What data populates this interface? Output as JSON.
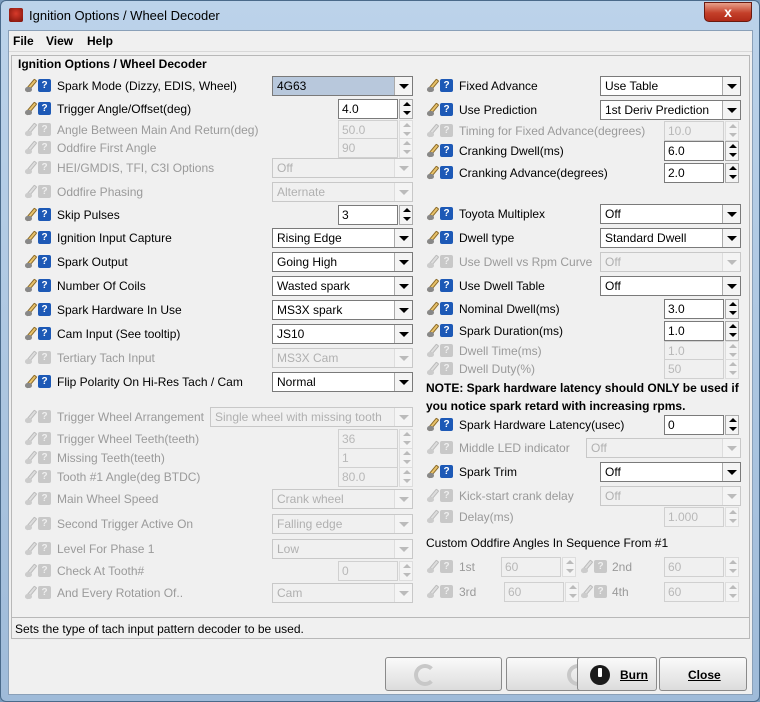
{
  "window": {
    "title": "Ignition Options / Wheel Decoder",
    "close_glyph": "x"
  },
  "menu": {
    "file": "File",
    "view": "View",
    "help": "Help"
  },
  "panel_title": "Ignition Options / Wheel Decoder",
  "left": {
    "spark_mode": {
      "label": "Spark Mode (Dizzy, EDIS, Wheel)",
      "value": "4G63"
    },
    "trigger_angle": {
      "label": "Trigger Angle/Offset(deg)",
      "value": "4.0"
    },
    "angle_between": {
      "label": "Angle Between Main And Return(deg)",
      "value": "50.0"
    },
    "oddfire_first": {
      "label": "Oddfire First Angle",
      "value": "90"
    },
    "hei_options": {
      "label": "HEI/GMDIS, TFI, C3I Options",
      "value": "Off"
    },
    "oddfire_phasing": {
      "label": "Oddfire Phasing",
      "value": "Alternate"
    },
    "skip_pulses": {
      "label": "Skip Pulses",
      "value": "3"
    },
    "input_capture": {
      "label": "Ignition Input Capture",
      "value": "Rising Edge"
    },
    "spark_output": {
      "label": "Spark Output",
      "value": "Going High"
    },
    "num_coils": {
      "label": "Number Of Coils",
      "value": "Wasted spark"
    },
    "spark_hw": {
      "label": "Spark Hardware In Use",
      "value": "MS3X spark"
    },
    "cam_input": {
      "label": "Cam Input (See tooltip)",
      "value": "JS10"
    },
    "tertiary": {
      "label": "Tertiary Tach Input",
      "value": "MS3X Cam"
    },
    "flip_polarity": {
      "label": "Flip Polarity On Hi-Res Tach / Cam",
      "value": "Normal"
    },
    "trigger_arr": {
      "label": "Trigger Wheel Arrangement",
      "value": "Single wheel with missing tooth"
    },
    "wheel_teeth": {
      "label": "Trigger Wheel Teeth(teeth)",
      "value": "36"
    },
    "missing_teeth": {
      "label": "Missing Teeth(teeth)",
      "value": "1"
    },
    "tooth1": {
      "label": "Tooth #1 Angle(deg BTDC)",
      "value": "80.0"
    },
    "main_speed": {
      "label": "Main Wheel Speed",
      "value": "Crank wheel"
    },
    "second_trigger": {
      "label": "Second Trigger Active On",
      "value": "Falling edge"
    },
    "level_phase": {
      "label": "Level For Phase 1",
      "value": "Low"
    },
    "check_tooth": {
      "label": "Check At Tooth#",
      "value": "0"
    },
    "every_rotation": {
      "label": "And Every Rotation Of..",
      "value": "Cam"
    }
  },
  "right": {
    "fixed_adv": {
      "label": "Fixed Advance",
      "value": "Use Table"
    },
    "use_pred": {
      "label": "Use Prediction",
      "value": "1st Deriv Prediction"
    },
    "timing_fixed": {
      "label": "Timing for Fixed Advance(degrees)",
      "value": "10.0"
    },
    "crank_dwell": {
      "label": "Cranking Dwell(ms)",
      "value": "6.0"
    },
    "crank_adv": {
      "label": "Cranking Advance(degrees)",
      "value": "2.0"
    },
    "toyota": {
      "label": "Toyota Multiplex",
      "value": "Off"
    },
    "dwell_type": {
      "label": "Dwell type",
      "value": "Standard Dwell"
    },
    "dwell_rpm": {
      "label": "Use Dwell vs Rpm Curve",
      "value": "Off"
    },
    "dwell_table": {
      "label": "Use Dwell Table",
      "value": "Off"
    },
    "nominal_dwell": {
      "label": "Nominal Dwell(ms)",
      "value": "3.0"
    },
    "spark_duration": {
      "label": "Spark Duration(ms)",
      "value": "1.0"
    },
    "dwell_time": {
      "label": "Dwell Time(ms)",
      "value": "1.0"
    },
    "dwell_duty": {
      "label": "Dwell Duty(%)",
      "value": "50"
    },
    "note1": "NOTE: Spark hardware latency should ONLY be used if",
    "note2": "you notice spark retard with increasing rpms.",
    "latency": {
      "label": "Spark Hardware Latency(usec)",
      "value": "0"
    },
    "middle_led": {
      "label": "Middle LED indicator",
      "value": "Off"
    },
    "spark_trim": {
      "label": "Spark Trim",
      "value": "Off"
    },
    "kick_start": {
      "label": "Kick-start crank delay",
      "value": "Off"
    },
    "delay": {
      "label": "Delay(ms)",
      "value": "1.000"
    },
    "custom_title": "Custom Oddfire Angles In Sequence From #1",
    "first": {
      "label": "1st",
      "value": "60"
    },
    "second": {
      "label": "2nd",
      "value": "60"
    },
    "third": {
      "label": "3rd",
      "value": "60"
    },
    "fourth": {
      "label": "4th",
      "value": "60"
    }
  },
  "status": "Sets the type of tach input pattern decoder to be used.",
  "buttons": {
    "burn": "Burn",
    "close": "Close"
  }
}
